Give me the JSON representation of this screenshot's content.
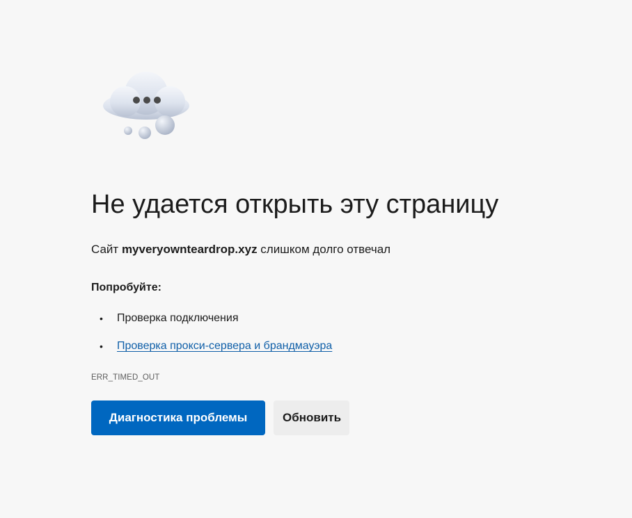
{
  "page": {
    "icon": "cloud-timeout-icon",
    "title": "Не удается открыть эту страницу",
    "subtitle_prefix": "Сайт ",
    "site": "myveryownteardrop.xyz",
    "subtitle_suffix": " слишком долго отвечал",
    "try_heading": "Попробуйте:",
    "suggestions": [
      {
        "text": "Проверка подключения",
        "is_link": false
      },
      {
        "text": "Проверка прокси-сервера и брандмауэра",
        "is_link": true
      }
    ],
    "error_code": "ERR_TIMED_OUT"
  },
  "buttons": {
    "diagnose_label": "Диагностика проблемы",
    "refresh_label": "Обновить"
  },
  "colors": {
    "background": "#f7f7f7",
    "primary_button": "#0067c0",
    "secondary_button": "#ededed",
    "link": "#0f5fa8"
  }
}
